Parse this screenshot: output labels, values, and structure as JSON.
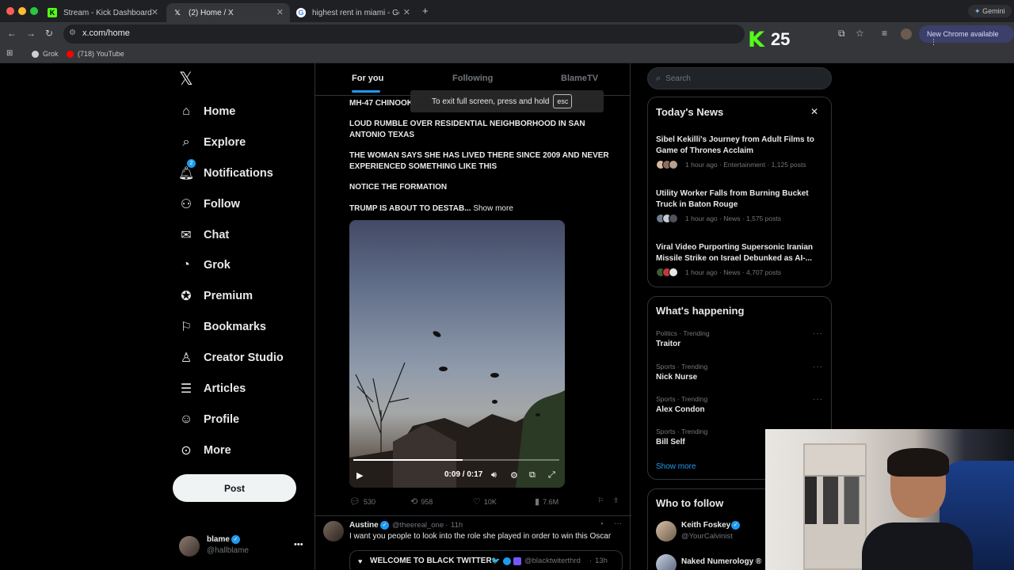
{
  "browser": {
    "tabs": [
      {
        "title": "Stream - Kick Dashboard",
        "icon": "kick-icon",
        "active": false
      },
      {
        "title": "(2) Home / X",
        "icon": "x-icon",
        "active": true
      },
      {
        "title": "highest rent in miami - Google",
        "icon": "google-icon",
        "active": false
      }
    ],
    "gemini_label": "Gemini",
    "url": "x.com/home",
    "new_chrome": "New Chrome available",
    "bookmarks": [
      {
        "label": "Grok",
        "color": "#cfcfcf"
      },
      {
        "label": "(718) YouTube",
        "color": "#ff0000"
      }
    ]
  },
  "kick_overlay": {
    "logo": "K",
    "count": "25",
    "color": "#53fc18"
  },
  "x": {
    "logo": "𝕏",
    "nav": [
      {
        "label": "Home",
        "icon": "home-icon",
        "glyph": "⌂"
      },
      {
        "label": "Explore",
        "icon": "search-icon",
        "glyph": "⌕"
      },
      {
        "label": "Notifications",
        "icon": "bell-icon",
        "glyph": "🔔︎",
        "badge": "2"
      },
      {
        "label": "Follow",
        "icon": "follow-icon",
        "glyph": "⚇"
      },
      {
        "label": "Chat",
        "icon": "mail-icon",
        "glyph": "✉"
      },
      {
        "label": "Grok",
        "icon": "grok-icon",
        "glyph": "◔"
      },
      {
        "label": "Premium",
        "icon": "premium-icon",
        "glyph": "✪"
      },
      {
        "label": "Bookmarks",
        "icon": "bookmark-icon",
        "glyph": "⚐"
      },
      {
        "label": "Creator Studio",
        "icon": "creator-studio-icon",
        "glyph": "♙"
      },
      {
        "label": "Articles",
        "icon": "articles-icon",
        "glyph": "☰"
      },
      {
        "label": "Profile",
        "icon": "profile-icon",
        "glyph": "☺"
      },
      {
        "label": "More",
        "icon": "more-icon",
        "glyph": "⊙"
      }
    ],
    "post_button": "Post",
    "account": {
      "name": "blame",
      "handle": "@hallblame"
    },
    "feed_tabs": [
      "For you",
      "Following",
      "BlameTV"
    ],
    "fullscreen_toast": {
      "text": "To exit full screen, press and hold",
      "key": "esc"
    },
    "post": {
      "lines": [
        "MH-47 CHINOOK",
        "LOUD RUMBLE OVER RESIDENTIAL NEIGHBORHOOD IN SAN ANTONIO TEXAS",
        "THE WOMAN SAYS SHE HAS LIVED THERE SINCE 2009 AND NEVER EXPERIENCED SOMETHING LIKE THIS",
        "NOTICE THE FORMATION",
        "TRUMP IS ABOUT TO DESTAB..."
      ],
      "show_more": "Show more",
      "video_time": "0:09 / 0:17",
      "video_progress": 0.53,
      "replies": "530",
      "reposts": "958",
      "likes": "10K",
      "views": "7.6M"
    },
    "tweet2": {
      "name": "Austine",
      "handle": "@theereal_one",
      "time": "11h",
      "text": "I want you people to look into the role she played in order to win this Oscar",
      "quote_name": "WELCOME TO BLACK TWITTER",
      "quote_emoji": "🐦",
      "quote_handle": "@blacktwiterthrd",
      "quote_time": "13h"
    },
    "search_placeholder": "Search",
    "todays_news": {
      "title": "Today's News",
      "items": [
        {
          "headline": "Sibel Kekilli's Journey from Adult Films to Game of Thrones Acclaim",
          "meta": "1 hour ago · Entertainment · 1,125 posts"
        },
        {
          "headline": "Utility Worker Falls from Burning Bucket Truck in Baton Rouge",
          "meta": "1 hour ago · News · 1,575 posts"
        },
        {
          "headline": "Viral Video Purporting Supersonic Iranian Missile Strike on Israel Debunked as AI-...",
          "meta": "1 hour ago · News · 4,707 posts"
        }
      ]
    },
    "whats_happening": {
      "title": "What's happening",
      "items": [
        {
          "category": "Politics · Trending",
          "name": "Traitor"
        },
        {
          "category": "Sports · Trending",
          "name": "Nick Nurse"
        },
        {
          "category": "Sports · Trending",
          "name": "Alex Condon"
        },
        {
          "category": "Sports · Trending",
          "name": "Bill Self"
        }
      ],
      "show_more": "Show more"
    },
    "who_to_follow": {
      "title": "Who to follow",
      "items": [
        {
          "name": "Keith Foskey",
          "handle": "@YourCalvinist"
        },
        {
          "name": "Naked Numerology ®",
          "handle": ""
        }
      ]
    }
  }
}
